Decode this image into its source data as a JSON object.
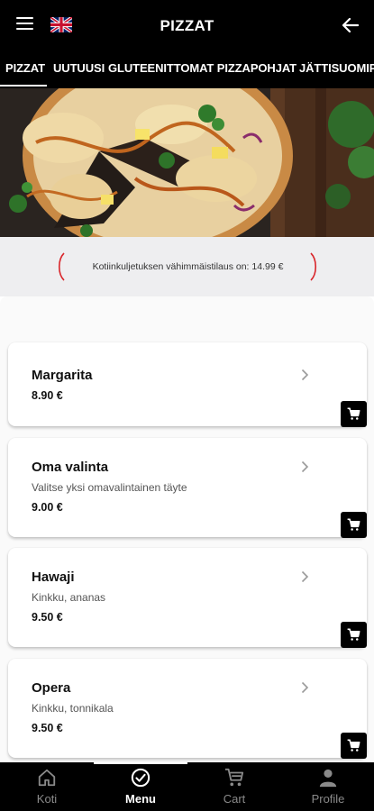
{
  "header": {
    "title": "PIZZAT",
    "menu_icon": "hamburger-menu-icon",
    "language_icon": "uk-flag-icon",
    "back_icon": "arrow-left-icon"
  },
  "tabs": [
    {
      "label": "PIZZAT",
      "active": true
    },
    {
      "label": "UUTUUSI",
      "active": false
    },
    {
      "label": "GLUTEENITTOMAT PIZZAPOHJAT",
      "active": false
    },
    {
      "label": "JÄTTISUOMIP",
      "active": false
    }
  ],
  "notice": {
    "text": "Kotiinkuljetuksen vähimmäistilaus on: 14.99 €"
  },
  "products": [
    {
      "name": "Margarita",
      "description": "",
      "price": "8.90 €"
    },
    {
      "name": "Oma valinta",
      "description": "Valitse yksi omavalintainen täyte",
      "price": "9.00 €"
    },
    {
      "name": "Hawaji",
      "description": "Kinkku, ananas",
      "price": "9.50 €"
    },
    {
      "name": "Opera",
      "description": "Kinkku, tonnikala",
      "price": "9.50 €"
    }
  ],
  "bottom_nav": [
    {
      "label": "Koti",
      "icon": "home-icon",
      "active": false
    },
    {
      "label": "Menu",
      "icon": "check-circle-icon",
      "active": true
    },
    {
      "label": "Cart",
      "icon": "cart-icon",
      "active": false
    },
    {
      "label": "Profile",
      "icon": "person-icon",
      "active": false
    }
  ],
  "colors": {
    "header_bg": "#000000",
    "accent_red": "#d9262b",
    "cart_button_bg": "#000000",
    "notice_band_bg": "#eeeef0"
  }
}
